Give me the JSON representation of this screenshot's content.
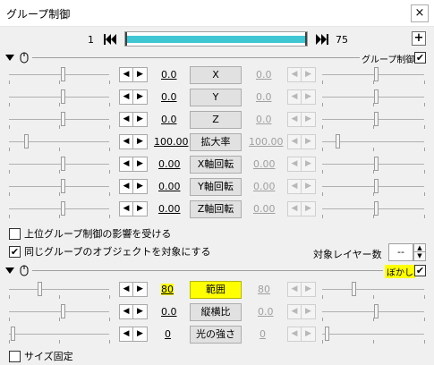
{
  "window": {
    "title": "グループ制御",
    "close_label": "×"
  },
  "timeline": {
    "start": "1",
    "end": "75",
    "progress": 1.0,
    "add_label": "+"
  },
  "group_section": {
    "label": "グループ制御",
    "enabled_mark": "✔"
  },
  "params": [
    {
      "name": "x",
      "label": "X",
      "value": "0.0",
      "end_value": "0.0"
    },
    {
      "name": "y",
      "label": "Y",
      "value": "0.0",
      "end_value": "0.0"
    },
    {
      "name": "z",
      "label": "Z",
      "value": "0.0",
      "end_value": "0.0"
    },
    {
      "name": "scale",
      "label": "拡大率",
      "value": "100.00",
      "end_value": "100.00"
    },
    {
      "name": "x-rot",
      "label": "X軸回転",
      "value": "0.00",
      "end_value": "0.00"
    },
    {
      "name": "y-rot",
      "label": "Y軸回転",
      "value": "0.00",
      "end_value": "0.00"
    },
    {
      "name": "z-rot",
      "label": "Z軸回転",
      "value": "0.00",
      "end_value": "0.00"
    }
  ],
  "options": {
    "upper_group": {
      "label": "上位グループ制御の影響を受ける",
      "checked": false
    },
    "same_group": {
      "label": "同じグループのオブジェクトを対象にする",
      "checked": true,
      "mark": "✔"
    },
    "target_layers": {
      "label": "対象レイヤー数",
      "value": "--"
    }
  },
  "blur_section": {
    "label": "ぼかし",
    "enabled_mark": "✔",
    "highlight_color": "#ffff00"
  },
  "blur_params": [
    {
      "name": "range",
      "label": "範囲",
      "value": "80",
      "end_value": "80"
    },
    {
      "name": "aspect",
      "label": "縦横比",
      "value": "0.0",
      "end_value": "0.0"
    },
    {
      "name": "light",
      "label": "光の強さ",
      "value": "0",
      "end_value": "0"
    }
  ],
  "fixed_size": {
    "label": "サイズ固定",
    "checked": false
  },
  "spin": {
    "left": "◀",
    "right": "▶"
  }
}
